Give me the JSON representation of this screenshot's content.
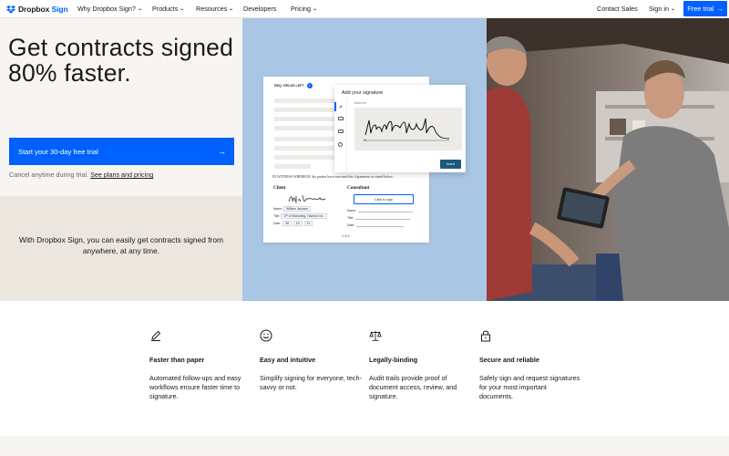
{
  "nav": {
    "logo_brand": "Dropbox",
    "logo_product": "Sign",
    "items": [
      {
        "label": "Why Dropbox Sign?",
        "has_dropdown": true
      },
      {
        "label": "Products",
        "has_dropdown": true
      },
      {
        "label": "Resources",
        "has_dropdown": true
      },
      {
        "label": "Developers",
        "has_dropdown": false
      },
      {
        "label": "Pricing",
        "has_dropdown": true
      }
    ],
    "contact_sales": "Contact Sales",
    "sign_in": "Sign in",
    "free_trial": "Free trial"
  },
  "hero": {
    "title": "Get contracts signed 80% faster.",
    "cta_label": "Start your 30-day free trial",
    "cancel_text": "Cancel anytime during trial.",
    "plans_link": "See plans and pricing",
    "subtext": "With Dropbox Sign, you can easily get contracts signed from anywhere, at any time."
  },
  "mockup": {
    "fields_left_label": "REQ. FIELDS LEFT",
    "fields_left_count": "2",
    "witness_text": "IN WITNESS WHEREOF, the parties have executed this Agreement as stated below:",
    "client_label": "Client",
    "consultant_label": "Consultant",
    "client_name_label": "Name:",
    "client_name": "William Jackson",
    "client_title_label": "Title:",
    "client_title": "VP of Marketing, Hanford Inc.",
    "client_date_label": "Date:",
    "client_date_m": "08",
    "client_date_d": "15",
    "client_date_y": "21",
    "consultant_name_label": "Name:",
    "consultant_title_label": "Title:",
    "consultant_date_label": "Date:",
    "click_to_sign": "Click to sign",
    "page_num": "3 of 3",
    "modal_title": "Add your signature",
    "draw_label": "Draw it in",
    "insert_button": "Insert"
  },
  "features": [
    {
      "icon": "pencil-icon",
      "title": "Faster than paper",
      "desc": "Automated follow-ups and easy workflows ensure faster time to signature."
    },
    {
      "icon": "smiley-icon",
      "title": "Easy and intuitive",
      "desc": "Simplify signing for everyone, tech-savvy or not."
    },
    {
      "icon": "scales-icon",
      "title": "Legally-binding",
      "desc": "Audit trails provide proof of document access, review, and signature."
    },
    {
      "icon": "lock-icon",
      "title": "Secure and reliable",
      "desc": "Safely sign and request signatures for your most important documents."
    }
  ],
  "colors": {
    "accent": "#0061fe",
    "hero_bg": "#f7f5f2",
    "hero_bg_lower": "#ebe6de",
    "panel_blue": "#a9c6e4"
  }
}
